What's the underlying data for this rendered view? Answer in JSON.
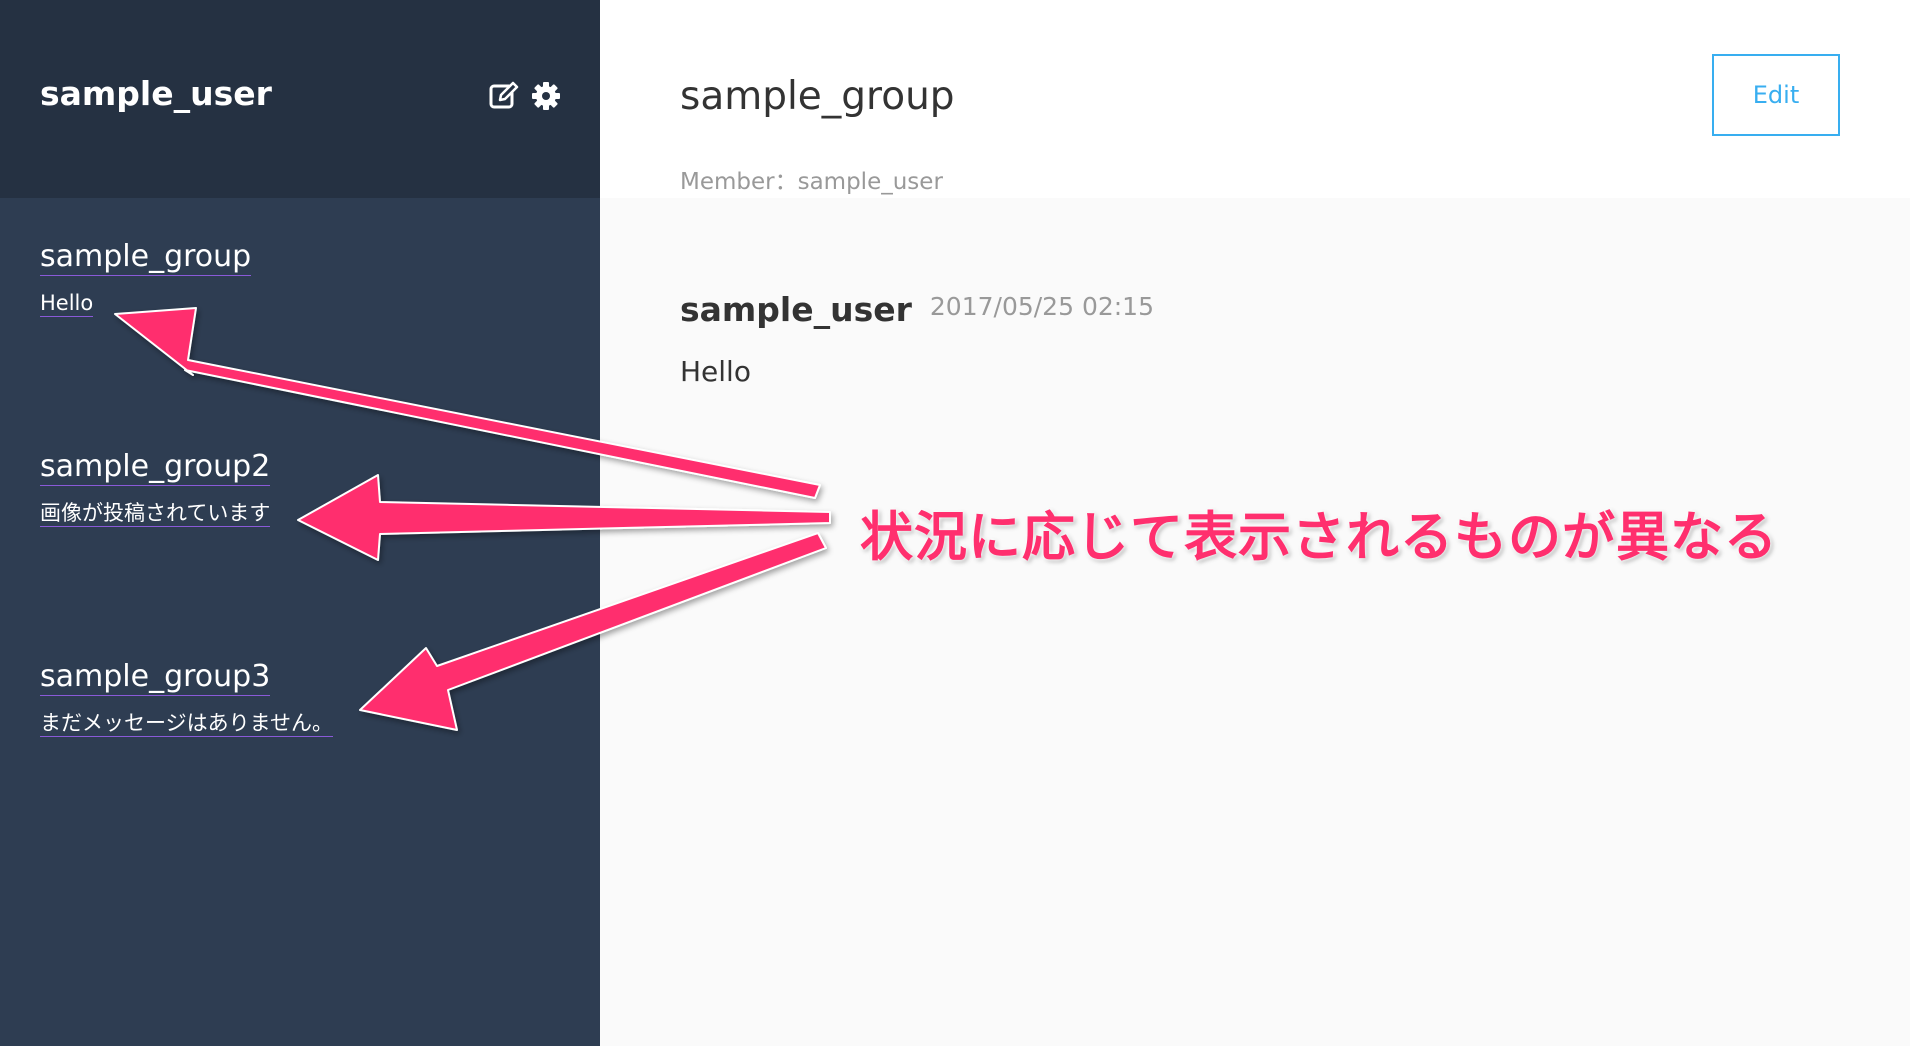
{
  "sidebar": {
    "user_name": "sample_user",
    "icons": [
      "edit-icon",
      "gear-icon"
    ],
    "groups": [
      {
        "name": "sample_group",
        "last_message": "Hello"
      },
      {
        "name": "sample_group2",
        "last_message": "画像が投稿されています"
      },
      {
        "name": "sample_group3",
        "last_message": "まだメッセージはありません。"
      }
    ]
  },
  "main": {
    "group_title": "sample_group",
    "member_line": "Member：sample_user",
    "edit_label": "Edit",
    "messages": [
      {
        "user": "sample_user",
        "time": "2017/05/25 02:15",
        "text": "Hello"
      }
    ]
  },
  "annotation": {
    "text": "状況に応じて表示されるものが異なる",
    "color": "#ff2f6e"
  },
  "colors": {
    "sidebar_bg": "#2e3d52",
    "sidebar_header_bg": "#253142",
    "accent": "#38aef0",
    "annotation": "#ff2f6e"
  }
}
